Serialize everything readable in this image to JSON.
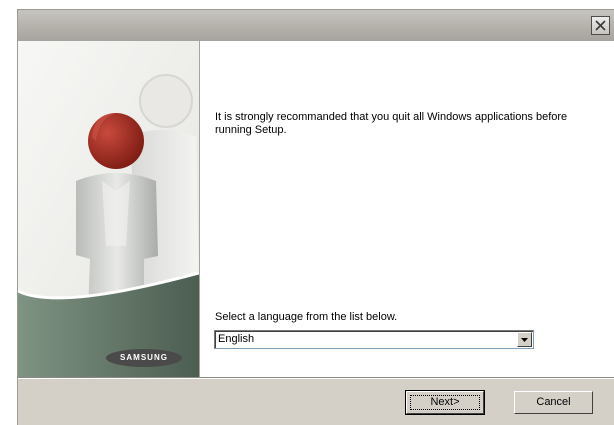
{
  "window": {
    "title": ""
  },
  "icons": {
    "close": "close-icon",
    "dropdown": "chevron-down-icon"
  },
  "main": {
    "message": "It is strongly recommanded that you quit all Windows applications before running Setup.",
    "language_prompt": "Select a language from the list below.",
    "language_selected": "English"
  },
  "sidebar": {
    "brand": "SAMSUNG"
  },
  "buttons": {
    "next": "Next>",
    "cancel": "Cancel"
  },
  "colors": {
    "window_bg": "#d4d0c8",
    "panel_bg": "#ffffff",
    "sidebar_green": "#5f7566",
    "figure_red": "#a62c22"
  }
}
